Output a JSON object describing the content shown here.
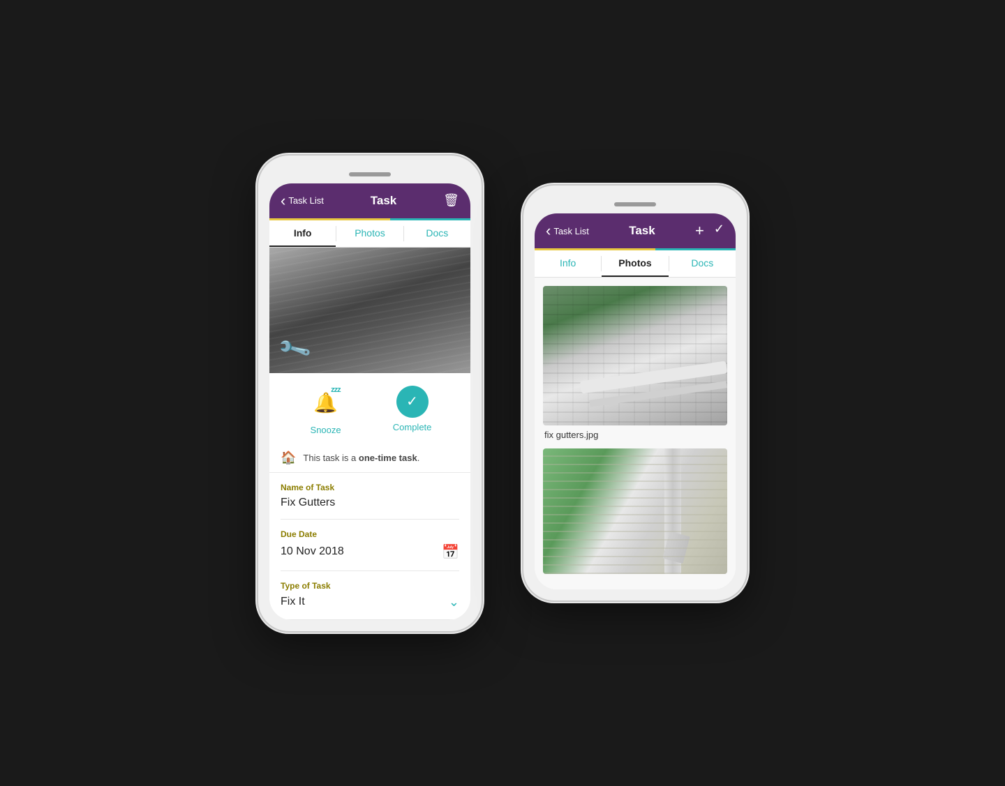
{
  "phones": [
    {
      "id": "left-phone",
      "header": {
        "back_label": "Task List",
        "title": "Task",
        "action_icon": "trash"
      },
      "accent_bar": true,
      "tabs": [
        {
          "id": "info",
          "label": "Info",
          "active": true
        },
        {
          "id": "photos",
          "label": "Photos",
          "active": false
        },
        {
          "id": "docs",
          "label": "Docs",
          "active": false
        }
      ],
      "hero": {
        "has_drill": true
      },
      "actions": [
        {
          "id": "snooze",
          "label": "Snooze",
          "type": "snooze"
        },
        {
          "id": "complete",
          "label": "Complete",
          "type": "complete"
        }
      ],
      "task_note": "This task is a one-time task.",
      "fields": [
        {
          "label": "Name of Task",
          "value": "Fix Gutters",
          "type": "text"
        },
        {
          "label": "Due Date",
          "value": "10 Nov 2018",
          "type": "date"
        },
        {
          "label": "Type of Task",
          "value": "Fix It",
          "type": "select"
        }
      ]
    },
    {
      "id": "right-phone",
      "header": {
        "back_label": "Task List",
        "title": "Task",
        "action_icons": [
          "plus",
          "check"
        ]
      },
      "accent_bar": true,
      "tabs": [
        {
          "id": "info",
          "label": "Info",
          "active": false
        },
        {
          "id": "photos",
          "label": "Photos",
          "active": true
        },
        {
          "id": "docs",
          "label": "Docs",
          "active": false
        }
      ],
      "photos": [
        {
          "filename": "fix gutters.jpg",
          "index": 1
        },
        {
          "filename": "",
          "index": 2
        }
      ]
    }
  ],
  "colors": {
    "header_bg": "#5b2d6e",
    "accent_yellow": "#e8c840",
    "accent_teal": "#2ab5b5",
    "label_color": "#8b7d00",
    "text_primary": "#222222",
    "text_light": "#444444"
  }
}
